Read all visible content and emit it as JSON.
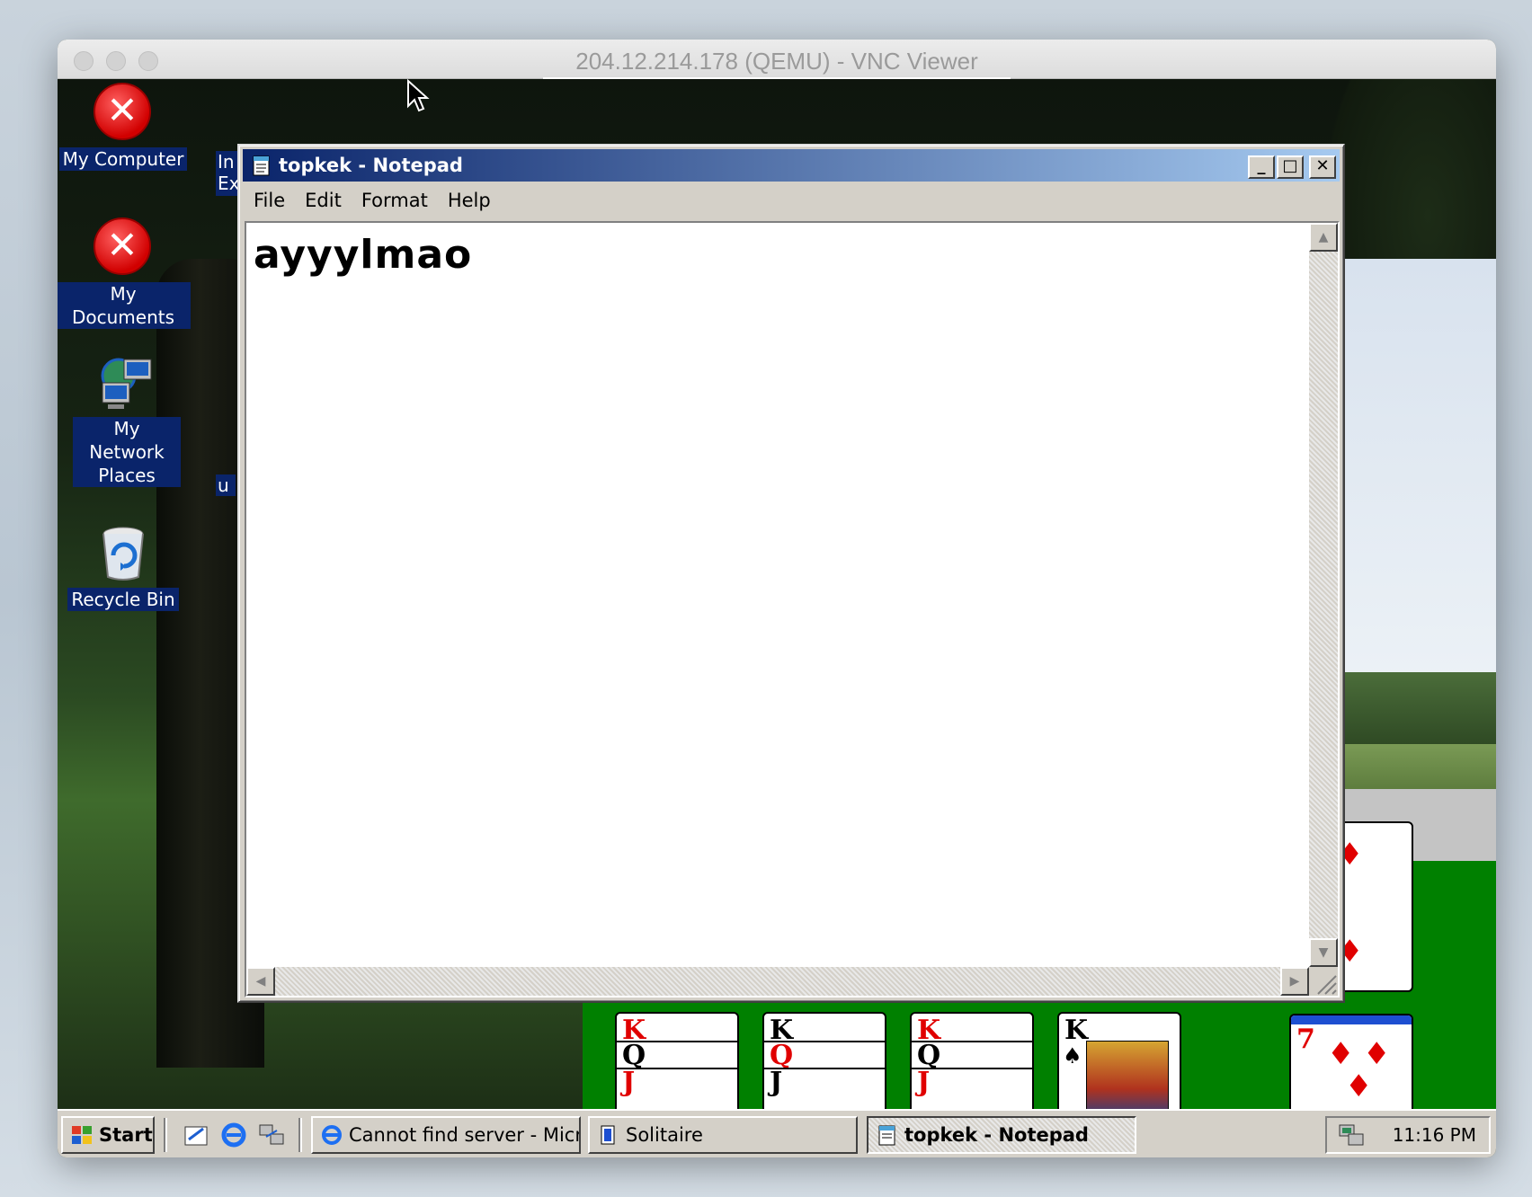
{
  "window": {
    "title": "204.12.214.178 (QEMU) - VNC Viewer"
  },
  "desktop": {
    "icons": [
      {
        "label": "My Computer",
        "icon": "error-x-icon"
      },
      {
        "label": "My Documents",
        "icon": "error-x-icon"
      },
      {
        "label": "My Network Places",
        "icon": "network-places-icon"
      },
      {
        "label": "Recycle Bin",
        "icon": "recycle-bin-icon"
      }
    ],
    "partial_labels": [
      "In",
      "Ex",
      "u"
    ]
  },
  "notepad": {
    "title": "topkek - Notepad",
    "menu": [
      "File",
      "Edit",
      "Format",
      "Help"
    ],
    "content": "ayyylmao",
    "buttons": {
      "minimize": "_",
      "maximize": "□",
      "close": "✕"
    }
  },
  "solitaire": {
    "cards": [
      {
        "rank": "2",
        "suit": "♦",
        "color": "red"
      },
      {
        "rank": "7",
        "suit": "♦",
        "color": "red"
      },
      {
        "rank": "K",
        "suit": "♠",
        "color": "black"
      },
      {
        "rank": "K",
        "suit": "♦",
        "color": "red"
      },
      {
        "rank": "Q",
        "suit": "",
        "color": "black"
      },
      {
        "rank": "J",
        "suit": "",
        "color": "red"
      }
    ]
  },
  "taskbar": {
    "start_label": "Start",
    "tasks": [
      {
        "label": "Cannot find server - Micr...",
        "icon": "ie-icon"
      },
      {
        "label": "Solitaire",
        "icon": "solitaire-icon"
      },
      {
        "label": "topkek - Notepad",
        "icon": "notepad-icon",
        "active": true
      }
    ],
    "clock": "11:16 PM"
  },
  "colors": {
    "title_active_start": "#0a246a",
    "title_active_end": "#a6caf0",
    "face": "#d4d0c8",
    "felt": "#008000"
  }
}
